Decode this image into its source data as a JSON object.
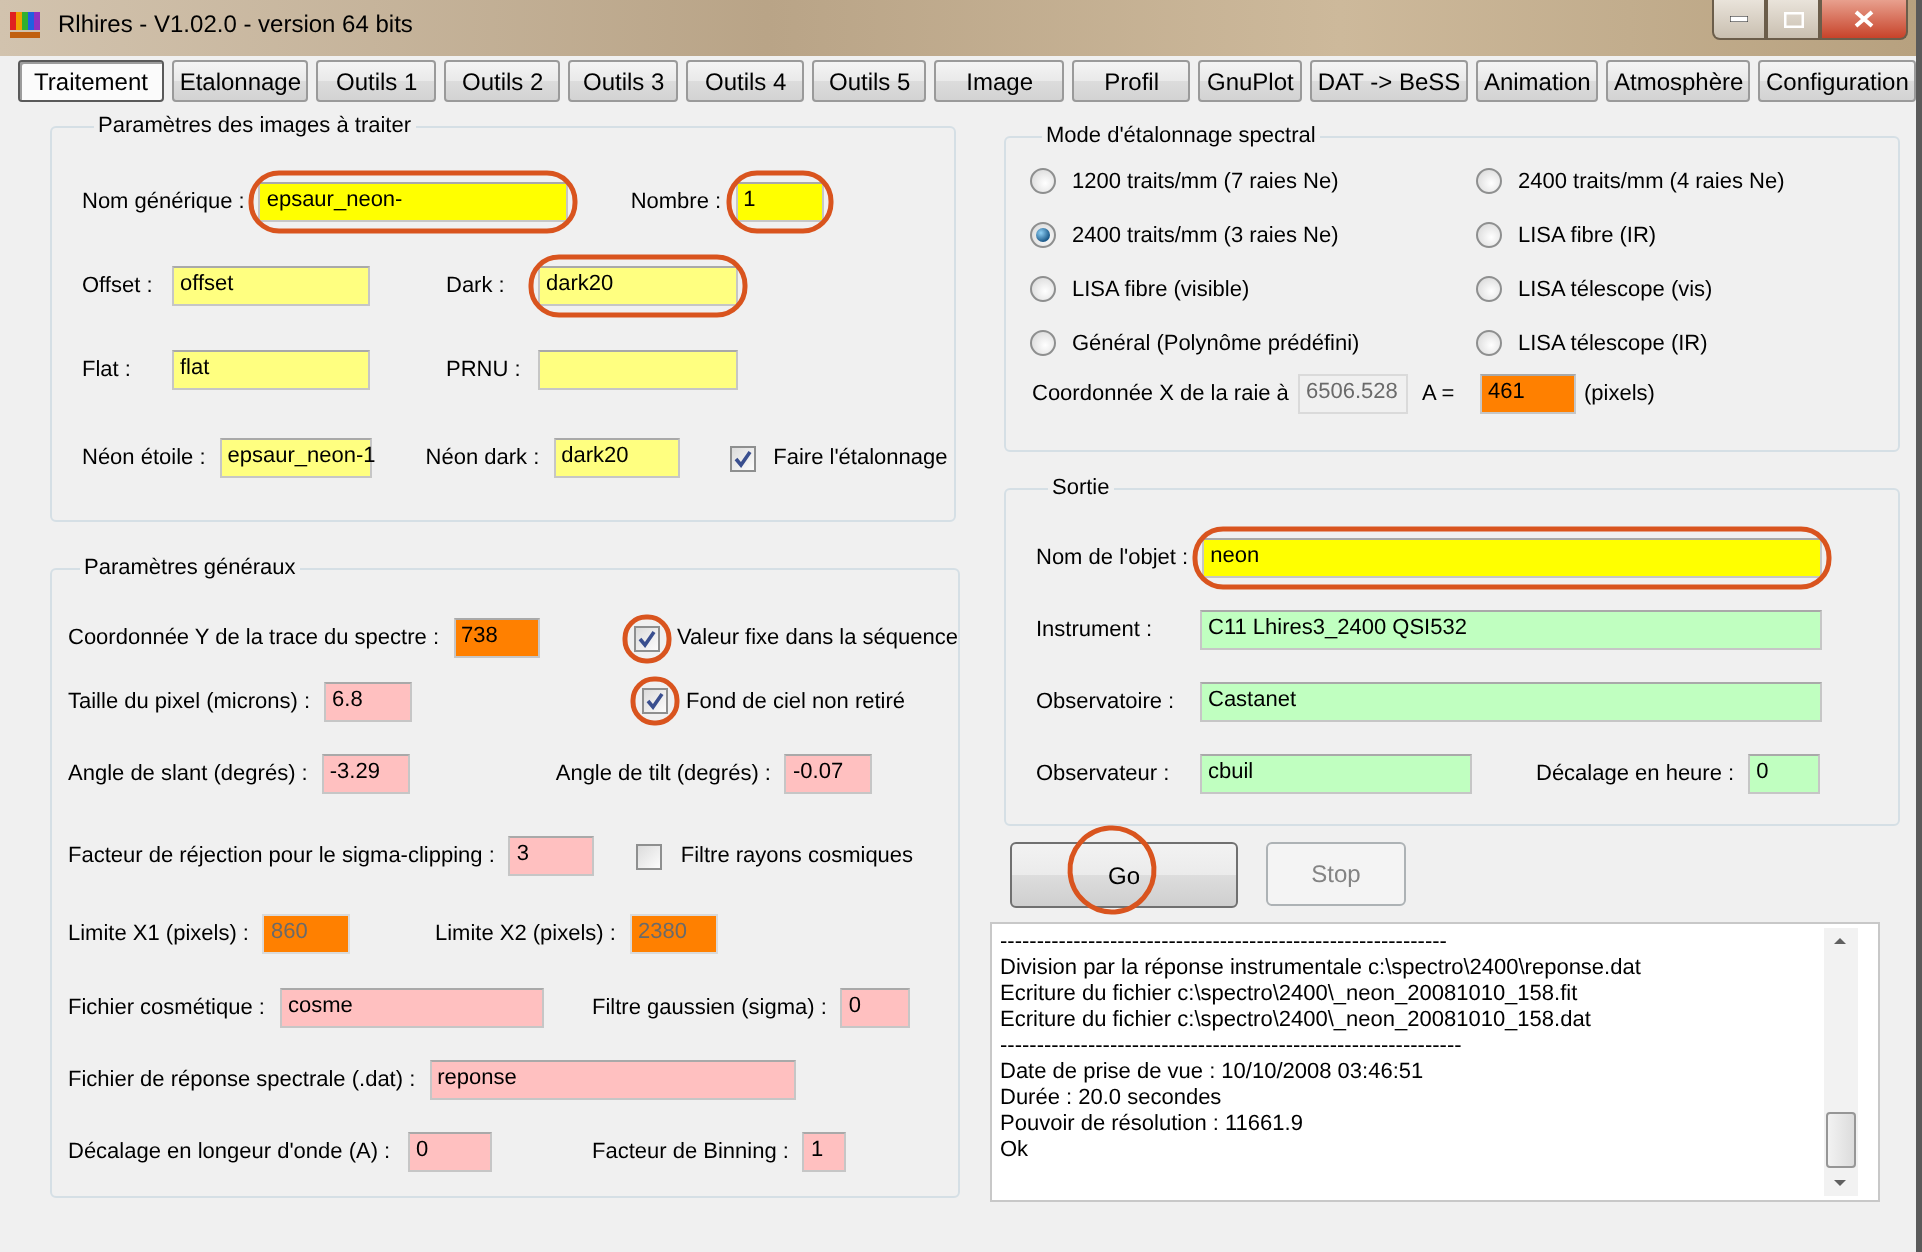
{
  "window": {
    "title": "Rlhires - V1.02.0 - version 64 bits"
  },
  "tabs": [
    {
      "label": "Traitement",
      "selected": true
    },
    {
      "label": "Etalonnage",
      "selected": false
    },
    {
      "label": "Outils 1",
      "selected": false
    },
    {
      "label": "Outils 2",
      "selected": false
    },
    {
      "label": "Outils 3",
      "selected": false
    },
    {
      "label": "Outils 4",
      "selected": false
    },
    {
      "label": "Outils 5",
      "selected": false
    },
    {
      "label": "Image",
      "selected": false
    },
    {
      "label": "Profil",
      "selected": false
    },
    {
      "label": "GnuPlot",
      "selected": false
    },
    {
      "label": "DAT -> BeSS",
      "selected": false
    },
    {
      "label": "Animation",
      "selected": false
    },
    {
      "label": "Atmosphère",
      "selected": false
    },
    {
      "label": "Configuration",
      "selected": false
    }
  ],
  "images_group": {
    "title": "Paramètres des images à traiter",
    "rows": [
      [
        {
          "kind": "field",
          "label": "Nom générique :",
          "value": "epsaur_neon-",
          "color": "#ffff00",
          "disabled": false,
          "circled": true
        },
        {
          "kind": "field",
          "label": "Nombre :",
          "value": "1",
          "color": "#ffff00",
          "disabled": false,
          "circled": true
        }
      ],
      [
        {
          "kind": "field",
          "label": "Offset :",
          "value": "offset",
          "color": "#ffff80",
          "disabled": false,
          "circled": false
        },
        {
          "kind": "field",
          "label": "Dark :",
          "value": "dark20",
          "color": "#ffff80",
          "disabled": false,
          "circled": true
        }
      ],
      [
        {
          "kind": "field",
          "label": "Flat :",
          "value": "flat",
          "color": "#ffff80",
          "disabled": false,
          "circled": false
        },
        {
          "kind": "field",
          "label": "PRNU :",
          "color": "#ffff80",
          "disabled": false,
          "circled": false
        }
      ],
      [
        {
          "kind": "field",
          "label": "Néon étoile :",
          "value": "epsaur_neon-1",
          "color": "#ffff80",
          "disabled": false,
          "circled": false
        },
        {
          "kind": "field",
          "label": "Néon dark :",
          "value": "dark20",
          "color": "#ffff80",
          "disabled": false,
          "circled": false
        },
        {
          "kind": "checkbox",
          "label": "Faire l'étalonnage",
          "checked": true,
          "circled": false
        }
      ]
    ]
  },
  "general_group": {
    "title": "Paramètres généraux",
    "rows": [
      [
        {
          "kind": "field",
          "label": "Coordonnée Y de la trace du spectre :",
          "value": "738",
          "color": "#ff8000",
          "disabled": false,
          "circled": false
        },
        {
          "kind": "checkbox",
          "label": "Valeur fixe dans la séquence",
          "checked": true,
          "circled": true
        }
      ],
      [
        {
          "kind": "field",
          "label": "Taille du pixel (microns) :",
          "value": "6.8",
          "color": "#ffc0c0",
          "disabled": false,
          "circled": false
        },
        {
          "kind": "checkbox",
          "label": "Fond de ciel non retiré",
          "checked": true,
          "circled": true
        }
      ],
      [
        {
          "kind": "field",
          "label": "Angle de slant (degrés) :",
          "value": "-3.29",
          "color": "#ffc0c0",
          "disabled": false,
          "circled": false
        },
        {
          "kind": "field",
          "label": "Angle de tilt (degrés) :",
          "value": "-0.07",
          "color": "#ffc0c0",
          "disabled": false,
          "circled": false
        }
      ],
      [
        {
          "kind": "field",
          "label": "Facteur de réjection pour le sigma-clipping :",
          "value": "3",
          "color": "#ffc0c0",
          "disabled": false,
          "circled": false
        },
        {
          "kind": "checkbox",
          "label": "Filtre rayons cosmiques",
          "checked": false,
          "circled": false
        }
      ],
      [
        {
          "kind": "field",
          "label": "Limite X1 (pixels) :",
          "value": "860",
          "color": "#ff8000",
          "disabled": true,
          "circled": false
        },
        {
          "kind": "field",
          "label": "Limite X2 (pixels) :",
          "value": "2380",
          "color": "#ff8000",
          "disabled": true,
          "circled": false
        }
      ],
      [
        {
          "kind": "field",
          "label": "Fichier cosmétique :",
          "value": "cosme",
          "color": "#ffc0c0",
          "disabled": false,
          "circled": false
        },
        {
          "kind": "field",
          "label": "Filtre gaussien (sigma) :",
          "value": "0",
          "color": "#ffc0c0",
          "disabled": false,
          "circled": false
        }
      ],
      [
        {
          "kind": "field",
          "label": "Fichier de réponse spectrale (.dat) :",
          "value": "reponse",
          "color": "#ffc0c0",
          "disabled": false,
          "circled": false
        }
      ],
      [
        {
          "kind": "field",
          "label": "Décalage en longeur d'onde (A) :",
          "value": "0",
          "color": "#ffc0c0",
          "disabled": false,
          "circled": false
        },
        {
          "kind": "field",
          "label": "Facteur de Binning :",
          "value": "1",
          "color": "#ffc0c0",
          "disabled": false,
          "circled": false
        }
      ]
    ]
  },
  "mode_group": {
    "title": "Mode d'étalonnage spectral",
    "options": [
      {
        "label": "1200 traits/mm (7 raies Ne)",
        "selected": false
      },
      {
        "label": "2400 traits/mm (4 raies Ne)",
        "selected": false
      },
      {
        "label": "2400 traits/mm (3 raies Ne)",
        "selected": true
      },
      {
        "label": "LISA fibre (IR)",
        "selected": false
      },
      {
        "label": "LISA fibre (visible)",
        "selected": false
      },
      {
        "label": "LISA télescope (vis)",
        "selected": false
      },
      {
        "label": "Général (Polynôme prédéfini)",
        "selected": false
      },
      {
        "label": "LISA télescope (IR)",
        "selected": false
      }
    ],
    "rows": [
      [
        {
          "kind": "text",
          "text": "Coordonnée X de la raie à"
        },
        {
          "kind": "field",
          "value": "6506.528",
          "color": "#f0f0f0",
          "disabled": true,
          "circled": false
        },
        {
          "kind": "text",
          "text": "A ="
        },
        {
          "kind": "field",
          "value": "461",
          "color": "#ff8000",
          "disabled": false,
          "circled": false
        },
        {
          "kind": "text",
          "text": "(pixels)"
        }
      ]
    ]
  },
  "output_group": {
    "title": "Sortie",
    "rows": [
      [
        {
          "kind": "field",
          "label": "Nom de l'objet :",
          "value": "neon",
          "color": "#ffff00",
          "disabled": false,
          "circled": true
        }
      ],
      [
        {
          "kind": "field",
          "label": "Instrument :",
          "value": "C11 Lhires3_2400 QSI532",
          "color": "#c0ffc0",
          "disabled": false,
          "circled": false
        }
      ],
      [
        {
          "kind": "field",
          "label": "Observatoire :",
          "value": "Castanet",
          "color": "#c0ffc0",
          "disabled": false,
          "circled": false
        }
      ],
      [
        {
          "kind": "field",
          "label": "Observateur :",
          "value": "cbuil",
          "color": "#c0ffc0",
          "disabled": false,
          "circled": false
        },
        {
          "kind": "field",
          "label": "Décalage en heure :",
          "value": "0",
          "color": "#c0ffc0",
          "disabled": false,
          "circled": false
        }
      ]
    ]
  },
  "buttons": [
    {
      "label": "Go",
      "disabled": false,
      "circled": true
    },
    {
      "label": "Stop",
      "disabled": true,
      "circled": false
    }
  ],
  "log": {
    "lines": [
      "-------------------------------------------------------------",
      "Division par la réponse instrumentale c:\\spectro\\2400\\reponse.dat",
      "Ecriture du fichier c:\\spectro\\2400\\_neon_20081010_158.fit",
      "Ecriture du fichier c:\\spectro\\2400\\_neon_20081010_158.dat",
      "---------------------------------------------------------------",
      "Date de prise de vue : 10/10/2008 03:46:51",
      "Durée : 20.0 secondes",
      "Pouvoir de résolution : 11661.9",
      "Ok"
    ]
  }
}
